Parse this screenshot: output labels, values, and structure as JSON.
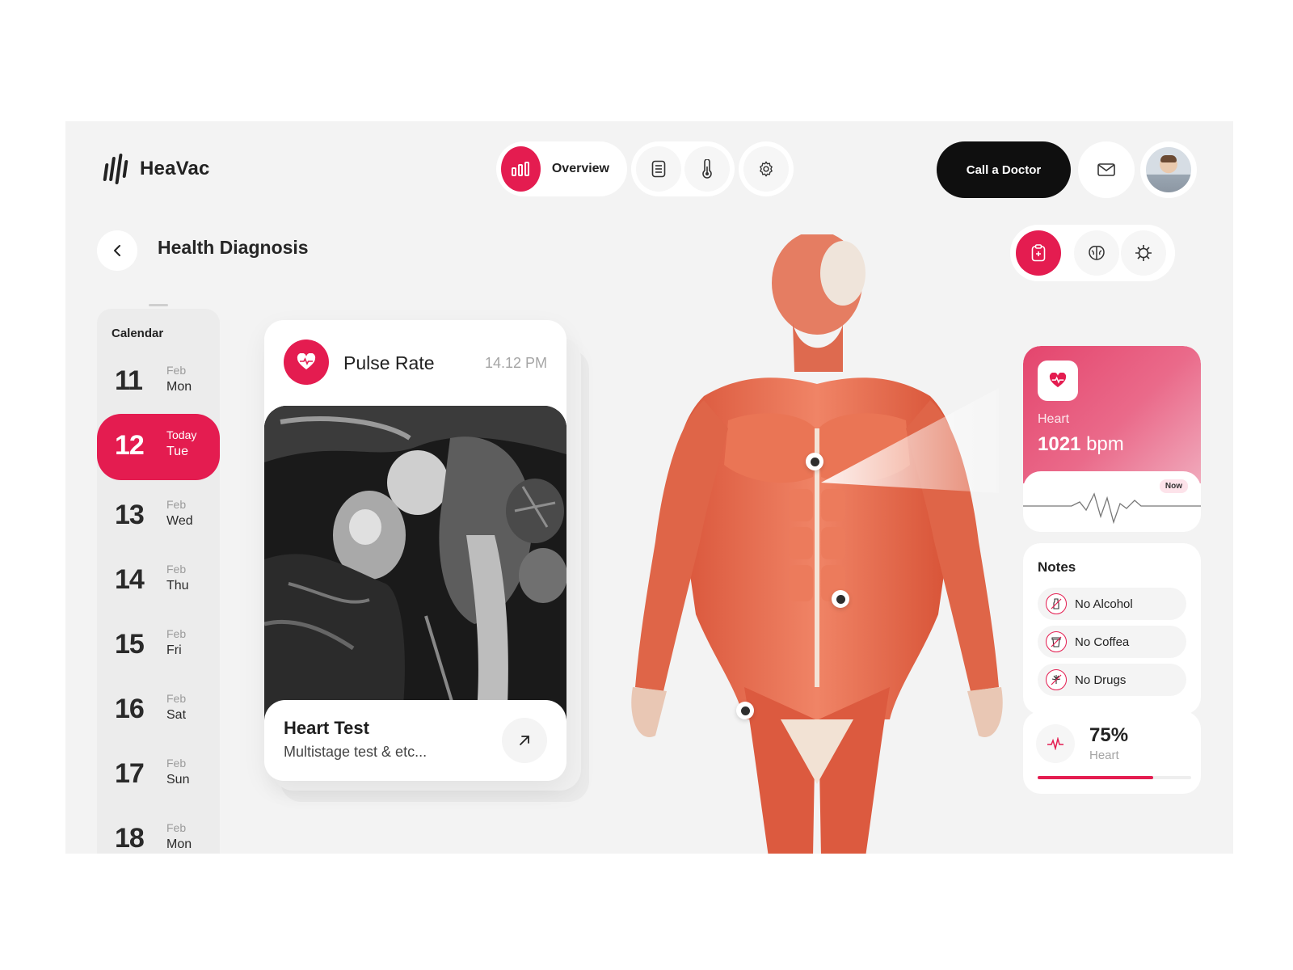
{
  "app": {
    "name": "HeaVac"
  },
  "nav": {
    "overview_label": "Overview",
    "call_label": "Call a Doctor"
  },
  "page": {
    "title": "Health Diagnosis"
  },
  "calendar": {
    "title": "Calendar",
    "days": [
      {
        "num": "11",
        "month": "Feb",
        "weekday": "Mon"
      },
      {
        "num": "12",
        "month": "Today",
        "weekday": "Tue",
        "active": true
      },
      {
        "num": "13",
        "month": "Feb",
        "weekday": "Wed"
      },
      {
        "num": "14",
        "month": "Feb",
        "weekday": "Thu"
      },
      {
        "num": "15",
        "month": "Feb",
        "weekday": "Fri"
      },
      {
        "num": "16",
        "month": "Feb",
        "weekday": "Sat"
      },
      {
        "num": "17",
        "month": "Feb",
        "weekday": "Sun"
      },
      {
        "num": "18",
        "month": "Feb",
        "weekday": "Mon"
      }
    ]
  },
  "pulse": {
    "label": "Pulse Rate",
    "time": "14.12 PM"
  },
  "heart_test": {
    "title": "Heart Test",
    "subtitle": "Multistage test & etc..."
  },
  "heart": {
    "label": "Heart",
    "value": "1021",
    "unit": "bpm",
    "badge": "Now"
  },
  "notes": {
    "title": "Notes",
    "items": [
      {
        "label": "No Alcohol",
        "icon": "alcohol-icon"
      },
      {
        "label": "No Coffea",
        "icon": "coffee-icon"
      },
      {
        "label": "No Drugs",
        "icon": "cannabis-icon"
      }
    ]
  },
  "heart_percent": {
    "value": "75%",
    "label": "Heart",
    "fraction": 0.75
  },
  "colors": {
    "accent": "#e41c50",
    "dark": "#0f0f0f",
    "background": "#f3f3f3"
  }
}
